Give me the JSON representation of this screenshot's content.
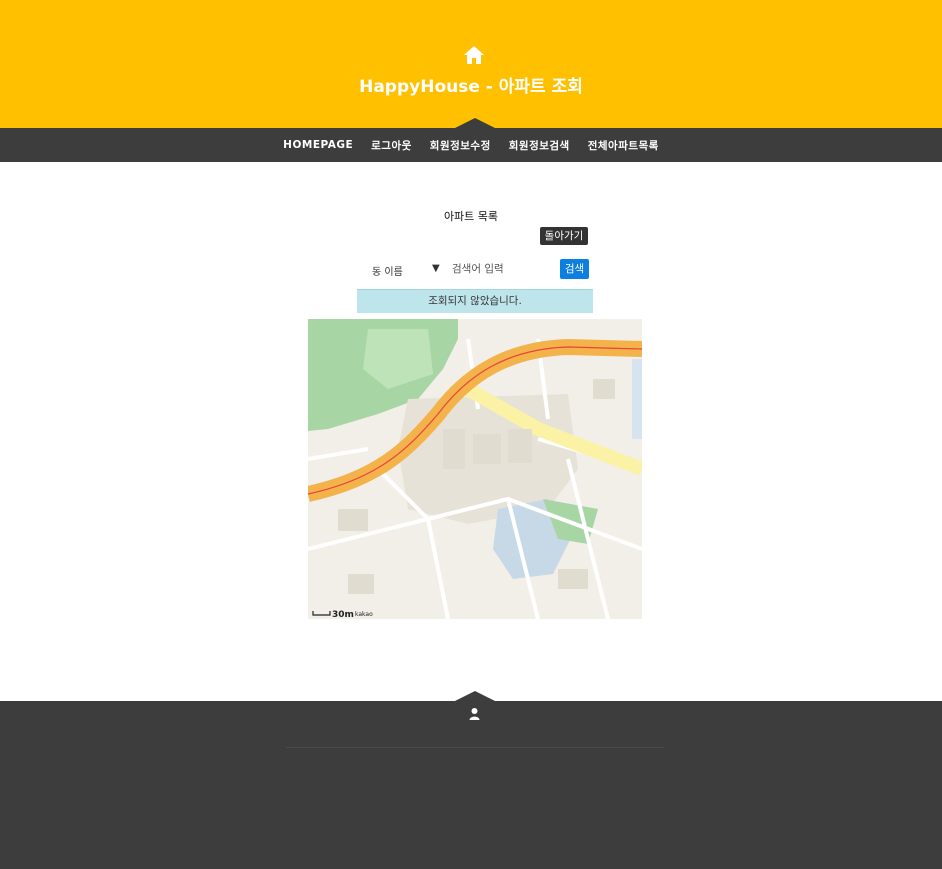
{
  "header": {
    "icon": "home-icon",
    "title": "HappyHouse - 아파트 조회",
    "background_color": "#ffc000"
  },
  "nav": {
    "items": [
      {
        "label": "HOMEPAGE"
      },
      {
        "label": "로그아웃"
      },
      {
        "label": "회원정보수정"
      },
      {
        "label": "회원정보검색"
      },
      {
        "label": "전체아파트목록"
      }
    ]
  },
  "main": {
    "title": "아파트 목록",
    "back_label": "돌아가기",
    "search": {
      "select_value": "동 이름",
      "placeholder": "검색어 입력",
      "button_label": "검색"
    },
    "alert": "조회되지 않았습니다.",
    "map": {
      "scale_label": "30m",
      "logo": "kakao"
    }
  },
  "footer": {
    "icon": "user-icon"
  }
}
